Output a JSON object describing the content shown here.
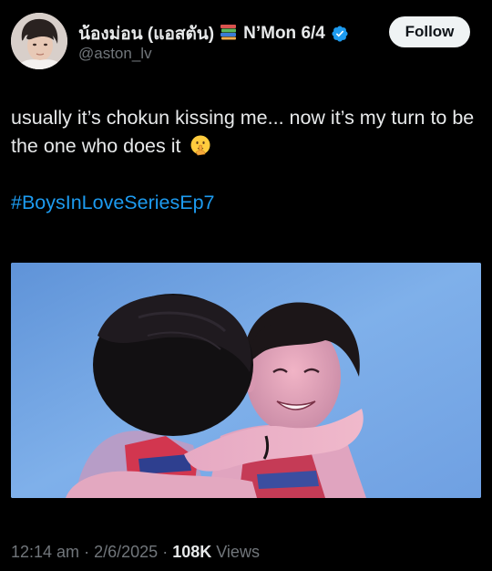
{
  "colors": {
    "background": "#000000",
    "text_primary": "#e7e9ea",
    "text_secondary": "#71767b",
    "accent": "#1d9bf0",
    "follow_button_bg": "#eff3f4",
    "follow_button_text": "#0f1419"
  },
  "author": {
    "display_name_thai": "น้องม่อน (แอสตัน)",
    "display_name_rest": "N’Mon 6/4",
    "name_emoji_icon": "books-icon",
    "handle": "@aston_lv",
    "verified": true,
    "verified_icon": "verified-badge-icon"
  },
  "follow_button": {
    "label": "Follow"
  },
  "tweet": {
    "text": "usually it’s chokun kissing me... now it’s my turn to be the one who does it",
    "text_emoji_icon": "shushing-face-icon",
    "hashtag": "#BoysInLoveSeriesEp7",
    "media_description_icon": "video-still-image"
  },
  "meta": {
    "time": "12:14 am",
    "separator": "·",
    "date": "2/6/2025",
    "views_count": "108K",
    "views_label": "Views"
  }
}
